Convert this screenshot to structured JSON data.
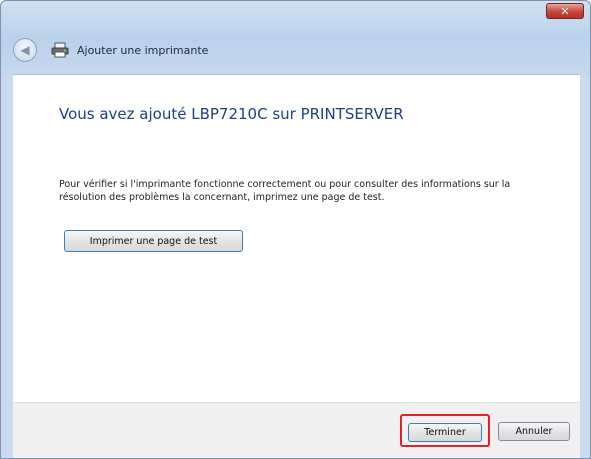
{
  "window": {
    "close_label": "✕"
  },
  "nav": {
    "title": "Ajouter une imprimante"
  },
  "content": {
    "heading": "Vous avez ajouté LBP7210C sur PRINTSERVER",
    "description": "Pour vérifier si l'imprimante fonctionne correctement ou pour consulter des informations sur la résolution des problèmes la concernant, imprimez une page de test.",
    "test_page_button": "Imprimer une page de test"
  },
  "footer": {
    "finish_button": "Terminer",
    "cancel_button": "Annuler"
  },
  "icons": {
    "back": "back-arrow-icon",
    "printer": "printer-icon",
    "close": "close-icon"
  },
  "colors": {
    "heading": "#1c3f87",
    "highlight": "#e0202a",
    "close_button": "#c8463a"
  }
}
